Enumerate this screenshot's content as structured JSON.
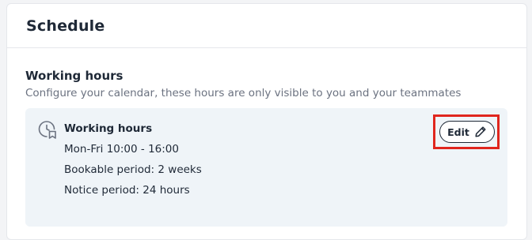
{
  "card": {
    "title": "Schedule"
  },
  "working_hours_section": {
    "title": "Working hours",
    "description": "Configure your calendar, these hours are only visible to you and your teammates"
  },
  "working_hours_panel": {
    "icon": "clock-calendar-icon",
    "title": "Working hours",
    "schedule": "Mon-Fri 10:00 - 16:00",
    "bookable_period": "Bookable period: 2 weeks",
    "notice_period": "Notice period: 24 hours",
    "edit_button": {
      "label": "Edit",
      "icon": "pencil-icon"
    }
  },
  "colors": {
    "panel_background": "#eff4f8",
    "highlight_border": "#e0261e",
    "text_primary": "#1f2937",
    "text_secondary": "#6b7280"
  }
}
